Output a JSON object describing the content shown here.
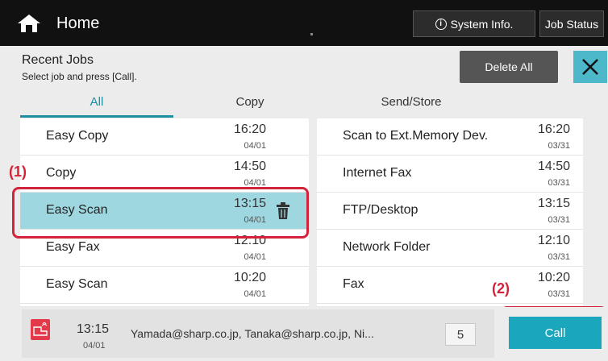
{
  "header": {
    "title": "Home",
    "system_info_label": "System Info.",
    "job_status_label": "Job Status"
  },
  "recent": {
    "title": "Recent Jobs",
    "subtitle": "Select job and press [Call].",
    "delete_all_label": "Delete All"
  },
  "tabs": [
    {
      "label": "All",
      "active": true
    },
    {
      "label": "Copy",
      "active": false
    },
    {
      "label": "Send/Store",
      "active": false
    }
  ],
  "left_jobs": [
    {
      "name": "Easy Copy",
      "time": "16:20",
      "date": "04/01"
    },
    {
      "name": "Copy",
      "time": "14:50",
      "date": "04/01"
    },
    {
      "name": "Easy Scan",
      "time": "13:15",
      "date": "04/01",
      "selected": true
    },
    {
      "name": "Easy Fax",
      "time": "12:10",
      "date": "04/01"
    },
    {
      "name": "Easy Scan",
      "time": "10:20",
      "date": "04/01"
    }
  ],
  "right_jobs": [
    {
      "name": "Scan to Ext.Memory Dev.",
      "time": "16:20",
      "date": "03/31"
    },
    {
      "name": "Internet Fax",
      "time": "14:50",
      "date": "03/31"
    },
    {
      "name": "FTP/Desktop",
      "time": "13:15",
      "date": "03/31"
    },
    {
      "name": "Network Folder",
      "time": "12:10",
      "date": "03/31"
    },
    {
      "name": "Fax",
      "time": "10:20",
      "date": "03/31"
    }
  ],
  "annotations": {
    "label_1": "(1)",
    "label_2": "(2)"
  },
  "selected_job": {
    "time": "13:15",
    "date": "04/01",
    "destinations": "Yamada@sharp.co.jp, Tanaka@sharp.co.jp, Ni...",
    "count": "5"
  },
  "call_label": "Call",
  "colors": {
    "accent": "#1c8fa3",
    "selected_row": "#9fd7e0",
    "annotation": "#d3233a",
    "call_button": "#1aa6bd",
    "close_button": "#4db8c9"
  }
}
